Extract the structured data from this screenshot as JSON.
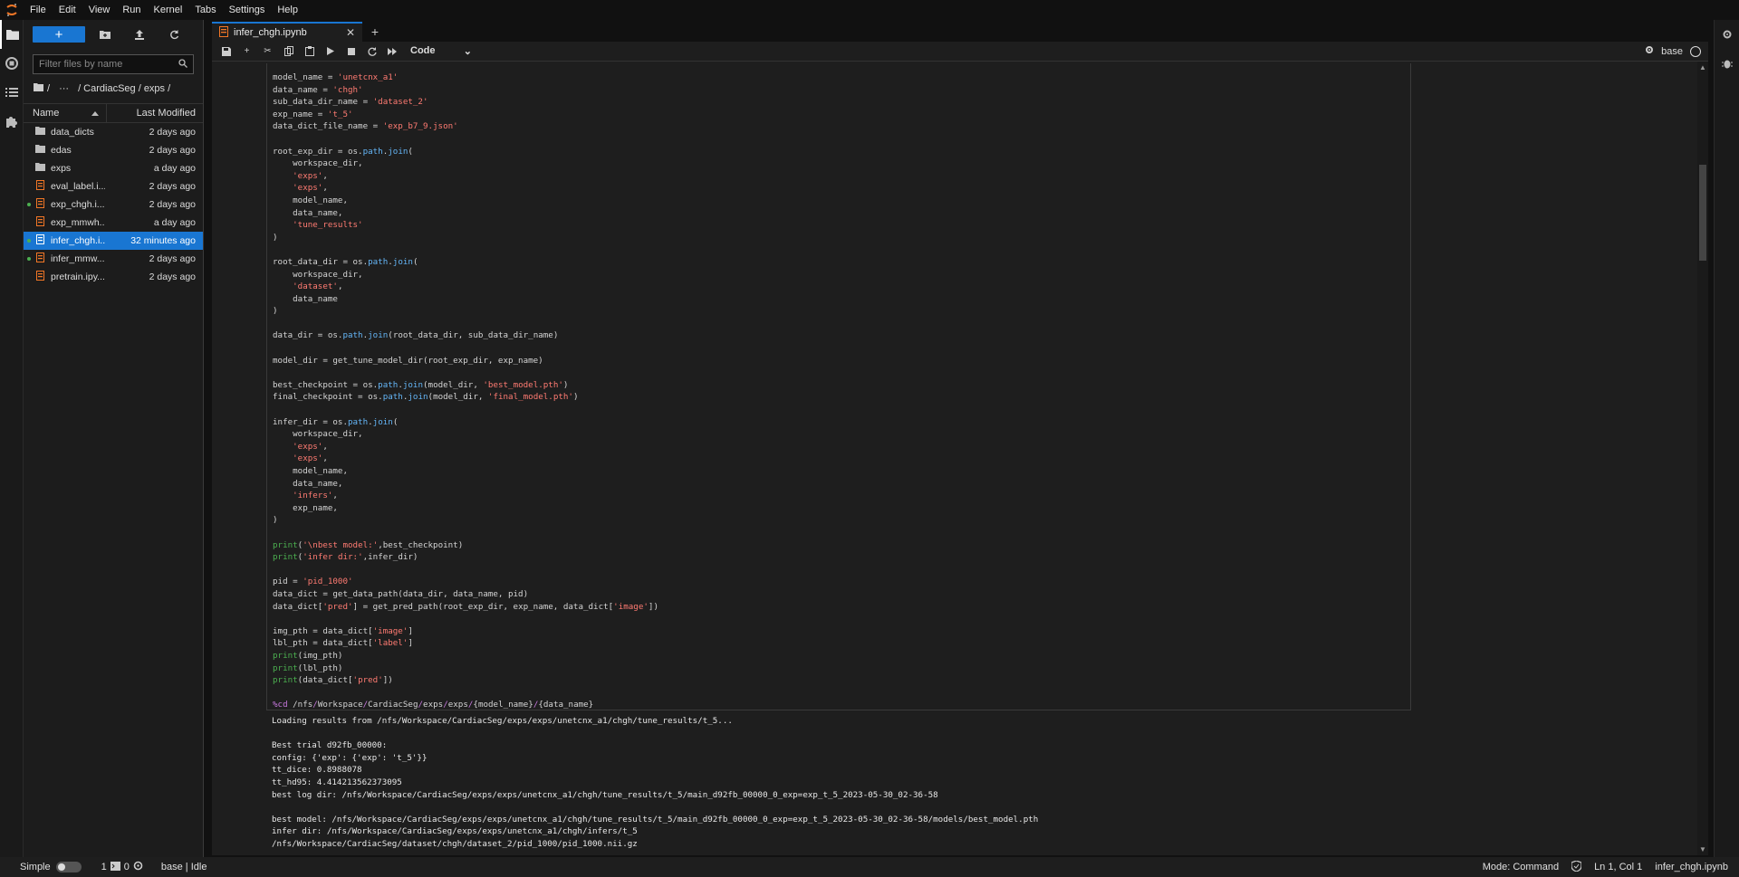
{
  "menu": [
    "File",
    "Edit",
    "View",
    "Run",
    "Kernel",
    "Tabs",
    "Settings",
    "Help"
  ],
  "filebrowser": {
    "new_label": "+",
    "search_placeholder": "Filter files by name",
    "breadcrumb": [
      "/",
      "···",
      "/ CardiacSeg / exps /"
    ],
    "col_name": "Name",
    "col_modified": "Last Modified",
    "items": [
      {
        "name": "data_dicts",
        "modified": "2 days ago",
        "type": "folder",
        "running": false,
        "selected": false
      },
      {
        "name": "edas",
        "modified": "2 days ago",
        "type": "folder",
        "running": false,
        "selected": false
      },
      {
        "name": "exps",
        "modified": "a day ago",
        "type": "folder",
        "running": false,
        "selected": false
      },
      {
        "name": "eval_label.i...",
        "modified": "2 days ago",
        "type": "notebook",
        "running": false,
        "selected": false
      },
      {
        "name": "exp_chgh.i...",
        "modified": "2 days ago",
        "type": "notebook",
        "running": true,
        "selected": false
      },
      {
        "name": "exp_mmwh...",
        "modified": "a day ago",
        "type": "notebook",
        "running": false,
        "selected": false
      },
      {
        "name": "infer_chgh.i...",
        "modified": "32 minutes ago",
        "type": "notebook",
        "running": true,
        "selected": true
      },
      {
        "name": "infer_mmw...",
        "modified": "2 days ago",
        "type": "notebook",
        "running": true,
        "selected": false
      },
      {
        "name": "pretrain.ipy...",
        "modified": "2 days ago",
        "type": "notebook",
        "running": false,
        "selected": false
      }
    ]
  },
  "tab": {
    "title": "infer_chgh.ipynb"
  },
  "toolbar": {
    "cell_type": "Code",
    "kernel": "base"
  },
  "output_lines": [
    "Loading results from /nfs/Workspace/CardiacSeg/exps/exps/unetcnx_a1/chgh/tune_results/t_5...",
    "",
    "Best trial d92fb_00000:",
    "config: {'exp': {'exp': 't_5'}}",
    "tt_dice: 0.8988078",
    "tt_hd95: 4.414213562373095",
    "best log dir: /nfs/Workspace/CardiacSeg/exps/exps/unetcnx_a1/chgh/tune_results/t_5/main_d92fb_00000_0_exp=exp_t_5_2023-05-30_02-36-58",
    "",
    "best model: /nfs/Workspace/CardiacSeg/exps/exps/unetcnx_a1/chgh/tune_results/t_5/main_d92fb_00000_0_exp=exp_t_5_2023-05-30_02-36-58/models/best_model.pth",
    "infer dir: /nfs/Workspace/CardiacSeg/exps/exps/unetcnx_a1/chgh/infers/t_5",
    "/nfs/Workspace/CardiacSeg/dataset/chgh/dataset_2/pid_1000/pid_1000.nii.gz"
  ],
  "status": {
    "mode_label": "Simple",
    "terminals": "1",
    "kernels": "0",
    "kernel_state": "base | Idle",
    "mode": "Mode: Command",
    "cursor": "Ln 1, Col 1",
    "file": "infer_chgh.ipynb"
  },
  "icons": {
    "accent": "#1976d2",
    "notebook": "#f37726",
    "running": "#4caf50"
  }
}
